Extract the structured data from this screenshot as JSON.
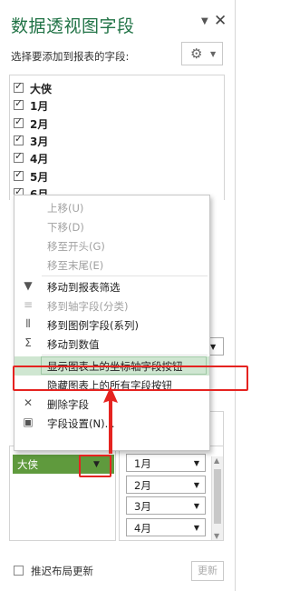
{
  "header": {
    "title": "数据透视图字段",
    "subtitle": "选择要添加到报表的字段:"
  },
  "fields": [
    {
      "label": "大侠",
      "checked": true
    },
    {
      "label": "1月",
      "checked": true
    },
    {
      "label": "2月",
      "checked": true
    },
    {
      "label": "3月",
      "checked": true
    },
    {
      "label": "4月",
      "checked": true
    },
    {
      "label": "5月",
      "checked": true
    },
    {
      "label": "6月",
      "checked": true
    }
  ],
  "context_menu": {
    "items": [
      {
        "label": "上移(U)",
        "enabled": false,
        "icon": ""
      },
      {
        "label": "下移(D)",
        "enabled": false,
        "icon": ""
      },
      {
        "label": "移至开头(G)",
        "enabled": false,
        "icon": ""
      },
      {
        "label": "移至末尾(E)",
        "enabled": false,
        "icon": ""
      },
      {
        "label": "移动到报表筛选",
        "enabled": true,
        "icon": "filter-icon"
      },
      {
        "label": "移到轴字段(分类)",
        "enabled": false,
        "icon": "rows-icon"
      },
      {
        "label": "移到图例字段(系列)",
        "enabled": true,
        "icon": "columns-icon"
      },
      {
        "label": "移动到数值",
        "enabled": true,
        "icon": "sigma-icon"
      },
      {
        "label": "显示图表上的坐标轴字段按钮",
        "enabled": true,
        "icon": "",
        "highlighted": true
      },
      {
        "label": "隐藏图表上的所有字段按钮",
        "enabled": true,
        "icon": ""
      },
      {
        "label": "删除字段",
        "enabled": true,
        "icon": "remove-x-icon"
      },
      {
        "label": "字段设置(N)...",
        "enabled": true,
        "icon": "field-settings-icon"
      }
    ]
  },
  "axis_area": {
    "field": "大侠"
  },
  "values_area": {
    "fields": [
      "1月",
      "2月",
      "3月",
      "4月"
    ]
  },
  "footer": {
    "defer_label": "推迟布局更新",
    "update_label": "更新"
  },
  "colors": {
    "accent": "#217346",
    "axis_pill": "#5f9a3d",
    "highlight": "#cfe6d1",
    "annotation": "#e52320"
  }
}
